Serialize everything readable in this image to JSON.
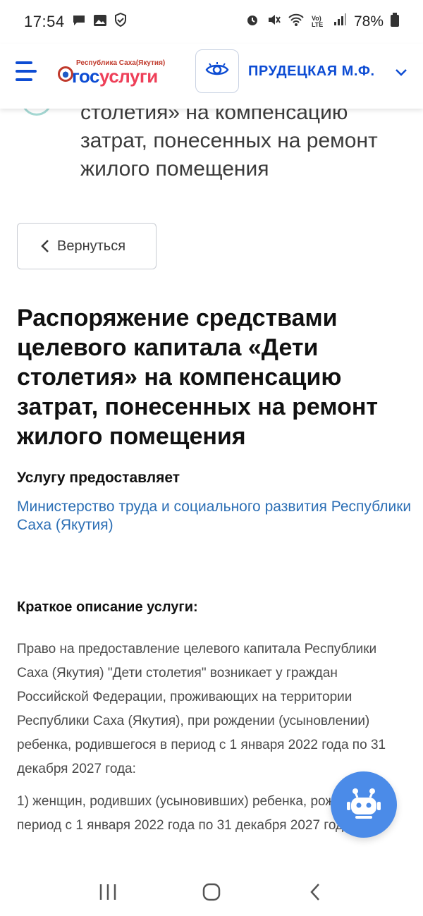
{
  "status_bar": {
    "time": "17:54",
    "left_icons": [
      "chat-bubble-icon",
      "image-icon",
      "shield-check-icon"
    ],
    "right_icons": [
      "alarm-icon",
      "mute-icon",
      "wifi-icon",
      "volte-icon",
      "signal-icon"
    ],
    "network_label": "Vo) LTE",
    "battery": "78%"
  },
  "header": {
    "logo_region": "Республика Саха(Якутия)",
    "logo_part1": "гос",
    "logo_part2": "услуги",
    "user_name": "ПРУДЕЦКАЯ М.Ф.",
    "accent_color": "#0d4cd3"
  },
  "scrolled_title": "столетия» на компенсацию затрат, понесенных на ремонт жилого помещения",
  "back_button": {
    "label": "Вернуться"
  },
  "service": {
    "title": "Распоряжение средствами целевого капитала «Дети столетия» на компенсацию затрат, понесенных на ремонт жилого помещения",
    "provider_label": "Услугу предоставляет",
    "provider_name": "Министерство труда и социального развития Республики Саха (Якутия)",
    "description_label": "Краткое описание услуги:",
    "description_p1": "Право на предоставление целевого капитала Республики Саха (Якутия) \"Дети столетия\" возникает у граждан Российской Федерации, проживающих на территории Республики Саха (Якутия), при рождении (усыновлении) ребенка, родившегося в период с 1 января 2022 года по 31 декабря 2027 года:",
    "description_p2": "1) женщин, родивших (усыновивших) ребенка, рожденного в период с 1 января 2022 года по 31 декабря 2027 года;"
  },
  "assistant": {
    "icon": "robot-icon",
    "color": "#4b8be8"
  },
  "nav_bar": {
    "icons": [
      "recent-apps-icon",
      "home-icon",
      "back-icon"
    ]
  }
}
